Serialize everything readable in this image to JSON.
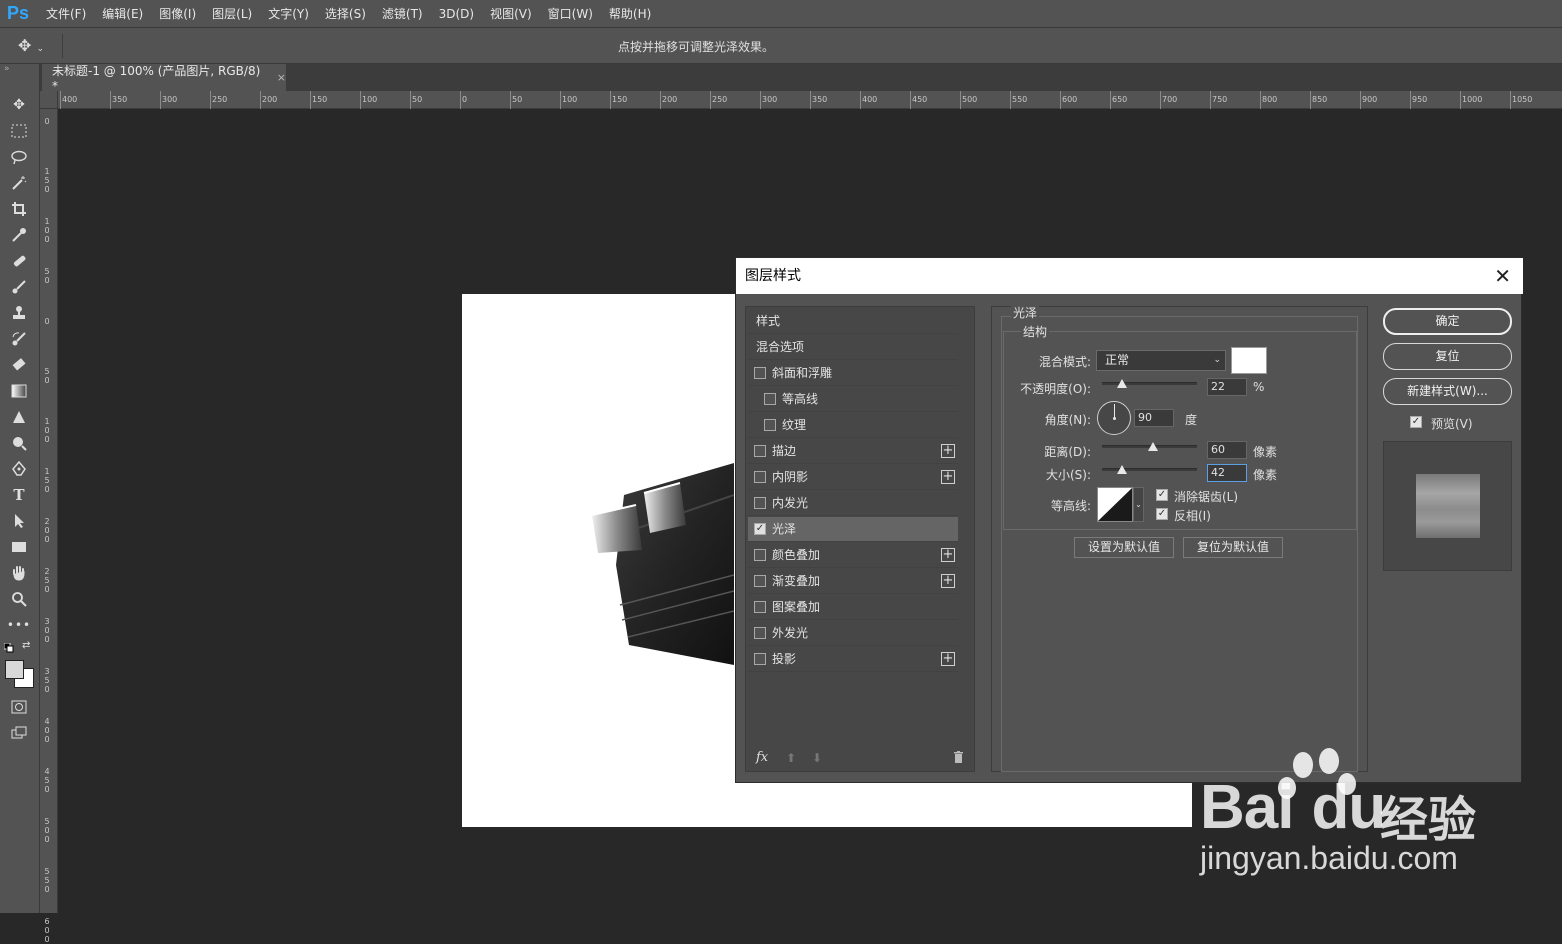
{
  "app": {
    "logo": "Ps"
  },
  "menu": [
    "文件(F)",
    "编辑(E)",
    "图像(I)",
    "图层(L)",
    "文字(Y)",
    "选择(S)",
    "滤镜(T)",
    "3D(D)",
    "视图(V)",
    "窗口(W)",
    "帮助(H)"
  ],
  "options_bar": {
    "hint": "点按并拖移可调整光泽效果。"
  },
  "document_tab": {
    "title": "未标题-1 @ 100% (产品图片, RGB/8) *",
    "close": "×"
  },
  "ruler_h": [
    "400",
    "350",
    "300",
    "250",
    "200",
    "150",
    "100",
    "50",
    "0",
    "50",
    "100",
    "150",
    "200",
    "250",
    "300",
    "350",
    "400",
    "450",
    "500",
    "550",
    "600",
    "650",
    "700",
    "750",
    "800",
    "850",
    "900",
    "950",
    "1000",
    "1050"
  ],
  "ruler_v": [
    "0",
    "150",
    "100",
    "50",
    "0",
    "50",
    "100",
    "150",
    "200",
    "250",
    "300",
    "350",
    "400",
    "450",
    "500",
    "550",
    "600"
  ],
  "dialog": {
    "title": "图层样式",
    "close": "✕",
    "styles_header": "样式",
    "blend_options": "混合选项",
    "effects": [
      {
        "label": "斜面和浮雕",
        "checked": false,
        "plus": false
      },
      {
        "label": "等高线",
        "checked": false,
        "plus": false
      },
      {
        "label": "纹理",
        "checked": false,
        "plus": false
      },
      {
        "label": "描边",
        "checked": false,
        "plus": true
      },
      {
        "label": "内阴影",
        "checked": false,
        "plus": true
      },
      {
        "label": "内发光",
        "checked": false,
        "plus": false
      },
      {
        "label": "光泽",
        "checked": true,
        "plus": false
      },
      {
        "label": "颜色叠加",
        "checked": false,
        "plus": true
      },
      {
        "label": "渐变叠加",
        "checked": false,
        "plus": true
      },
      {
        "label": "图案叠加",
        "checked": false,
        "plus": false
      },
      {
        "label": "外发光",
        "checked": false,
        "plus": false
      },
      {
        "label": "投影",
        "checked": false,
        "plus": true
      }
    ],
    "footer": {
      "fx": "fx",
      "up": "⬆",
      "down": "⬇",
      "trash": "🗑"
    },
    "satin": {
      "group_title": "光泽",
      "structure_title": "结构",
      "blend_mode_label": "混合模式:",
      "blend_mode_value": "正常",
      "color": "#ffffff",
      "opacity_label": "不透明度(O):",
      "opacity_value": "22",
      "opacity_unit": "%",
      "angle_label": "角度(N):",
      "angle_value": "90",
      "angle_unit": "度",
      "distance_label": "距离(D):",
      "distance_value": "60",
      "distance_unit": "像素",
      "size_label": "大小(S):",
      "size_value": "42",
      "size_unit": "像素",
      "contour_label": "等高线:",
      "antialias_label": "消除锯齿(L)",
      "antialias_checked": true,
      "invert_label": "反相(I)",
      "invert_checked": true,
      "make_default": "设置为默认值",
      "reset_default": "复位为默认值"
    },
    "buttons": {
      "ok": "确定",
      "reset": "复位",
      "new_style": "新建样式(W)...",
      "preview_label": "预览(V)"
    }
  },
  "watermark": {
    "brand": "Bai",
    "brand2": "du",
    "cn": "经验",
    "url": "jingyan.baidu.com"
  }
}
